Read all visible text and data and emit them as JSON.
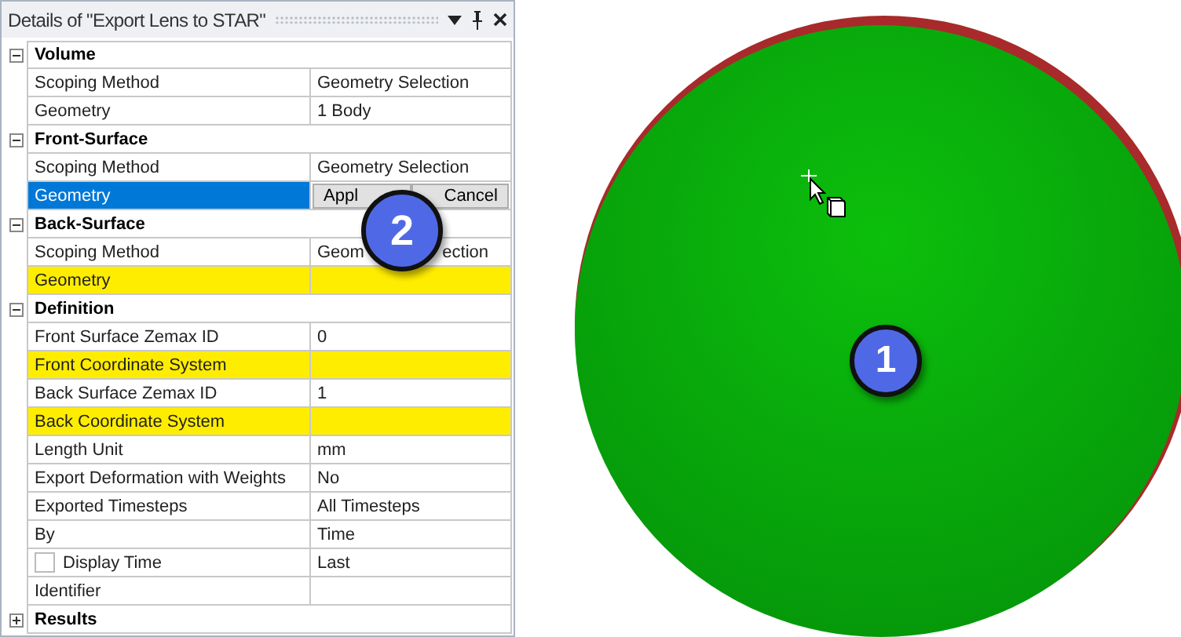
{
  "panel": {
    "title": "Details of \"Export Lens to STAR\""
  },
  "sections": [
    {
      "title": "Volume",
      "expanded": true,
      "rows": [
        {
          "kind": "text",
          "name": "Scoping Method",
          "value": "Geometry Selection",
          "selected": false
        },
        {
          "kind": "text",
          "name": "Geometry",
          "value": "1 Body",
          "selected": false
        }
      ]
    },
    {
      "title": "Front-Surface",
      "expanded": true,
      "rows": [
        {
          "kind": "text",
          "name": "Scoping Method",
          "value": "Geometry Selection",
          "selected": false
        },
        {
          "kind": "editing",
          "name": "Geometry",
          "buttons": [
            "Appl",
            "Cancel"
          ],
          "selected": true
        }
      ]
    },
    {
      "title": "Back-Surface",
      "expanded": true,
      "rows": [
        {
          "kind": "split",
          "name": "Scoping Method",
          "value_parts": [
            "Geom",
            "ection"
          ],
          "selected": false
        },
        {
          "kind": "required",
          "name": "Geometry",
          "selected": false
        }
      ]
    },
    {
      "title": "Definition",
      "expanded": true,
      "rows": [
        {
          "kind": "text",
          "name": "Front Surface Zemax ID",
          "value": "0",
          "selected": false
        },
        {
          "kind": "required",
          "name": "Front Coordinate System",
          "selected": false
        },
        {
          "kind": "text",
          "name": "Back Surface Zemax ID",
          "value": "1",
          "selected": false
        },
        {
          "kind": "required",
          "name": "Back Coordinate System",
          "selected": false
        },
        {
          "kind": "text",
          "name": "Length Unit",
          "value": "mm",
          "selected": false
        },
        {
          "kind": "text",
          "name": "Export Deformation with Weights",
          "value": "No",
          "selected": false
        },
        {
          "kind": "text",
          "name": "Exported Timesteps",
          "value": "All Timesteps",
          "selected": false
        },
        {
          "kind": "text",
          "name": "By",
          "value": "Time",
          "selected": false
        },
        {
          "kind": "checkbox",
          "name": "Display Time",
          "value": "Last",
          "checked": false,
          "selected": false
        },
        {
          "kind": "text",
          "name": "Identifier",
          "selected": false
        }
      ]
    },
    {
      "title": "Results",
      "expanded": false
    }
  ],
  "callouts": [
    "1",
    "2"
  ]
}
